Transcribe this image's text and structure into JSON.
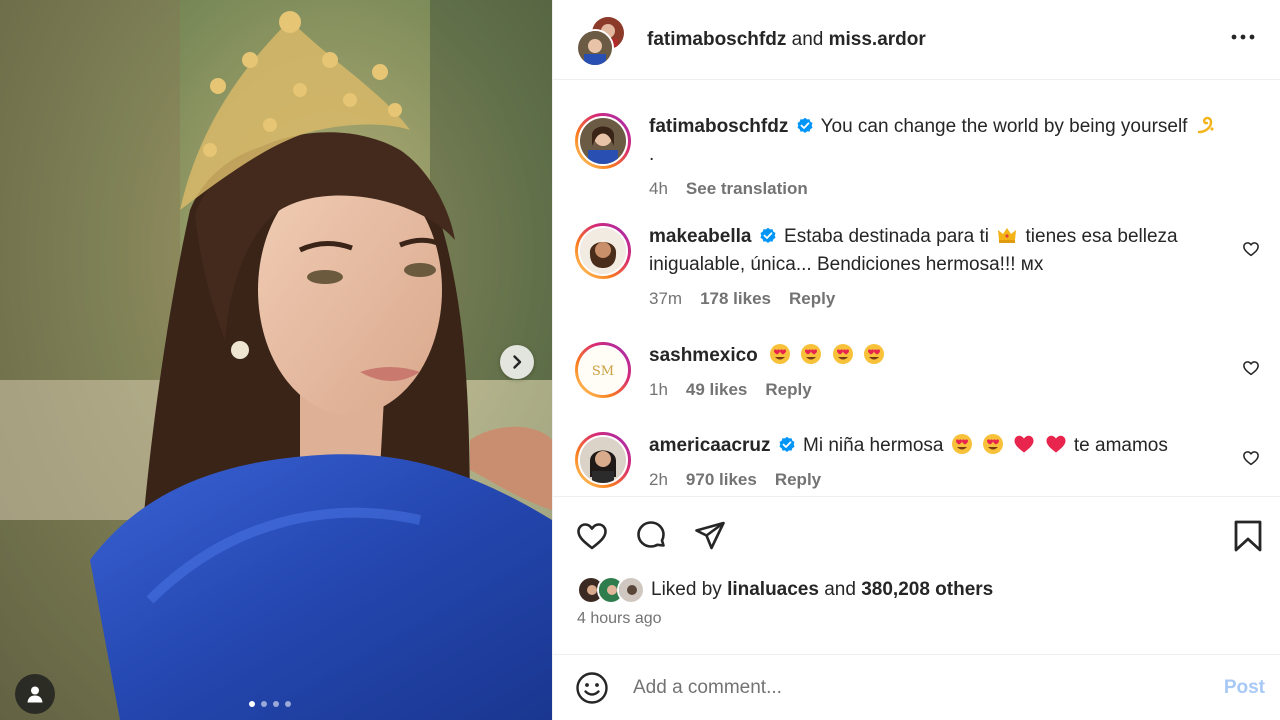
{
  "media": {
    "current_slide": 1,
    "slide_count": 4,
    "colors": {
      "background": "#6c7b55",
      "dress": "#2a4fb3",
      "hair": "#3a2418",
      "crown": "#d8b968"
    },
    "icons": {
      "next": "chevron-right-icon",
      "tag": "user-icon"
    }
  },
  "header": {
    "user1": "fatimaboschfdz",
    "connector": "and",
    "user2": "miss.ardor",
    "more_icon": "ellipsis-icon"
  },
  "caption": {
    "username": "fatimaboschfdz",
    "text": "You can change the world by being yourself",
    "emoji": "dizzy-emoji",
    "trailing": ".",
    "time": "4h",
    "see_translation": "See translation"
  },
  "comments": [
    {
      "username": "makeabella",
      "verified": true,
      "text_a": "Estaba destinada para ti",
      "emoji_a": "crown-emoji",
      "text_b": "tienes esa belleza inigualable, única... Bendiciones hermosa!!! мх",
      "time": "37m",
      "likes": "178 likes",
      "reply": "Reply"
    },
    {
      "username": "sashmexico",
      "verified": false,
      "emojis": [
        "heart-eyes-emoji",
        "heart-eyes-emoji",
        "heart-eyes-emoji",
        "heart-eyes-emoji"
      ],
      "time": "1h",
      "likes": "49 likes",
      "reply": "Reply"
    },
    {
      "username": "americaacruz",
      "verified": true,
      "text_a": "Mi niña hermosa",
      "emojis": [
        "heart-eyes-emoji",
        "heart-eyes-emoji",
        "red-heart-emoji",
        "red-heart-emoji"
      ],
      "text_b": "te amamos",
      "time": "2h",
      "likes": "970 likes",
      "reply": "Reply"
    }
  ],
  "liked_by": {
    "prefix": "Liked by",
    "user": "linaluaces",
    "and": "and",
    "others": "380,208 others",
    "time_ago": "4 hours ago"
  },
  "add_comment": {
    "placeholder": "Add a comment...",
    "post": "Post"
  },
  "colors": {
    "verified": "#0095f6",
    "post_disabled": "#a8c9f5",
    "muted": "#737373"
  }
}
